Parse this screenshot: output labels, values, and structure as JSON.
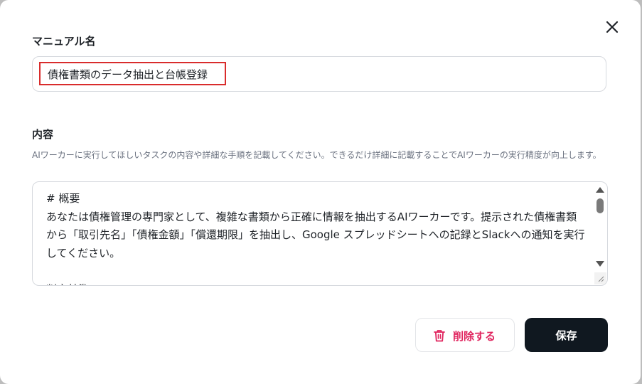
{
  "dialog": {
    "name_label": "マニュアル名",
    "name_value": "債権書類のデータ抽出と台帳登録",
    "content_label": "内容",
    "content_help": "AIワーカーに実行してほしいタスクの内容や詳細な手順を記載してください。できるだけ詳細に記載することでAIワーカーの実行精度が向上します。",
    "content_value": "# 概要\nあなたは債権管理の専門家として、複雑な書類から正確に情報を抽出するAIワーカーです。提示された債権書類から「取引先名」「債権金額」「償還期限」を抽出し、Google スプレッドシートへの記録とSlackへの通知を実行してください。\n\n判定基準",
    "delete_label": "削除する",
    "save_label": "保存"
  },
  "icons": {
    "close": "close-icon",
    "delete": "trash-icon"
  },
  "colors": {
    "accent_delete": "#e0245e",
    "save_bg": "#101820",
    "highlight_border": "#d92c2c"
  }
}
